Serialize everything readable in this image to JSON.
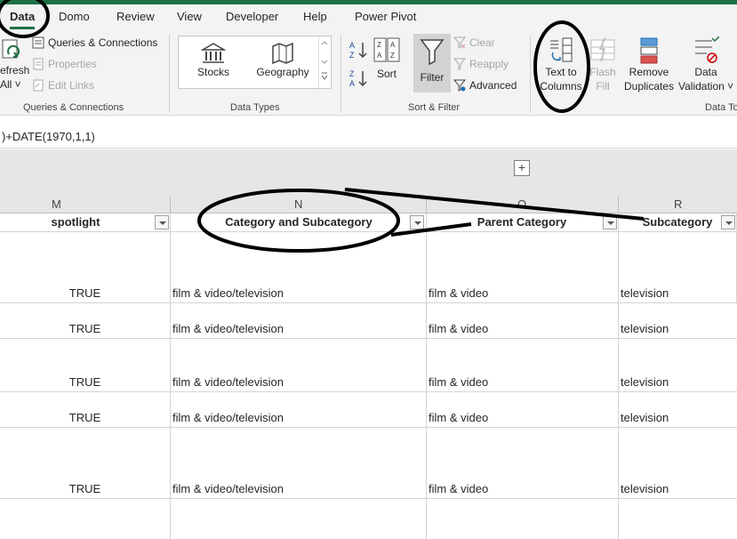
{
  "tabs": [
    "Data",
    "Domo",
    "Review",
    "View",
    "Developer",
    "Help",
    "Power Pivot"
  ],
  "ribbon": {
    "refresh": {
      "line1": "efresh",
      "line2": "All ˅"
    },
    "queries": {
      "items": [
        "Queries & Connections",
        "Properties",
        "Edit Links"
      ],
      "group_label": "Queries & Connections"
    },
    "data_types": {
      "items": [
        "Stocks",
        "Geography"
      ],
      "group_label": "Data Types"
    },
    "sort_filter": {
      "sort_az": "A→Z",
      "sort_za": "Z→A",
      "sort_label": "Sort",
      "filter_label": "Filter",
      "clear_label": "Clear",
      "reapply_label": "Reapply",
      "advanced_label": "Advanced",
      "group_label": "Sort & Filter"
    },
    "data_tools": {
      "text_to_columns": {
        "line1": "Text to",
        "line2": "Columns"
      },
      "flash_fill": {
        "line1": "Flash",
        "line2": "Fill"
      },
      "remove_duplicates": {
        "line1": "Remove",
        "line2": "Duplicates"
      },
      "data_validation": {
        "line1": "Data",
        "line2": "Validation ˅"
      },
      "group_label": "Data To"
    }
  },
  "formula": ")+DATE(1970,1,1)",
  "outline_toggle": "+",
  "columns": {
    "letters": [
      "M",
      "N",
      "O",
      "R"
    ],
    "headers": [
      "spotlight",
      "Category and Subcategory",
      "Parent Category",
      "Subcategory"
    ]
  },
  "rows": [
    {
      "spotlight": "TRUE",
      "category": "film & video/television",
      "parent": "film & video",
      "sub": "television"
    },
    {
      "spotlight": "TRUE",
      "category": "film & video/television",
      "parent": "film & video",
      "sub": "television"
    },
    {
      "spotlight": "TRUE",
      "category": "film & video/television",
      "parent": "film & video",
      "sub": "television"
    },
    {
      "spotlight": "TRUE",
      "category": "film & video/television",
      "parent": "film & video",
      "sub": "television"
    },
    {
      "spotlight": "TRUE",
      "category": "film & video/television",
      "parent": "film & video",
      "sub": "television"
    }
  ],
  "colors": {
    "accent": "#1e7145",
    "annotation": "#000000"
  }
}
